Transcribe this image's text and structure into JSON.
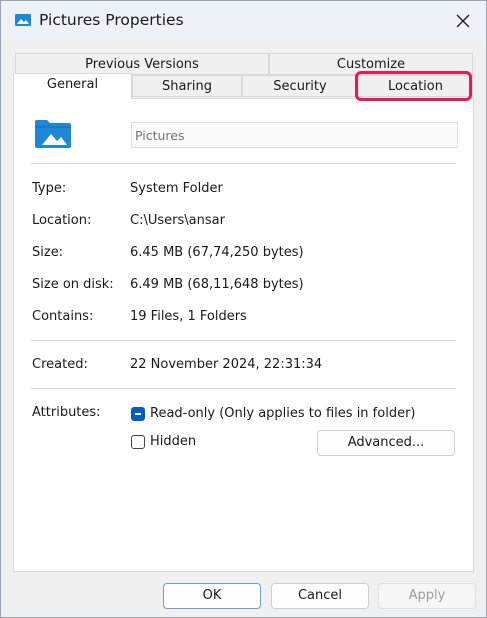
{
  "window": {
    "title": "Pictures Properties"
  },
  "tabs": {
    "previous_versions": "Previous Versions",
    "customize": "Customize",
    "general": "General",
    "sharing": "Sharing",
    "security": "Security",
    "location": "Location"
  },
  "general": {
    "folder_name_placeholder": "Pictures",
    "rows": {
      "type": {
        "label": "Type:",
        "value": "System Folder"
      },
      "location": {
        "label": "Location:",
        "value": "C:\\Users\\ansar"
      },
      "size": {
        "label": "Size:",
        "value": "6.45 MB (67,74,250 bytes)"
      },
      "size_on_disk": {
        "label": "Size on disk:",
        "value": "6.49 MB (68,11,648 bytes)"
      },
      "contains": {
        "label": "Contains:",
        "value": "19 Files, 1 Folders"
      },
      "created": {
        "label": "Created:",
        "value": "22 November 2024, 22:31:34"
      }
    },
    "attributes": {
      "label": "Attributes:",
      "read_only": "Read-only (Only applies to files in folder)",
      "hidden": "Hidden",
      "advanced_button": "Advanced..."
    }
  },
  "buttons": {
    "ok": "OK",
    "cancel": "Cancel",
    "apply": "Apply"
  },
  "colors": {
    "accent": "#005fb8",
    "highlight": "#e8185c",
    "folder": "#1e88d8"
  },
  "icons": {
    "title": "pictures-folder-icon",
    "close": "close-icon",
    "folder": "pictures-folder-icon"
  }
}
